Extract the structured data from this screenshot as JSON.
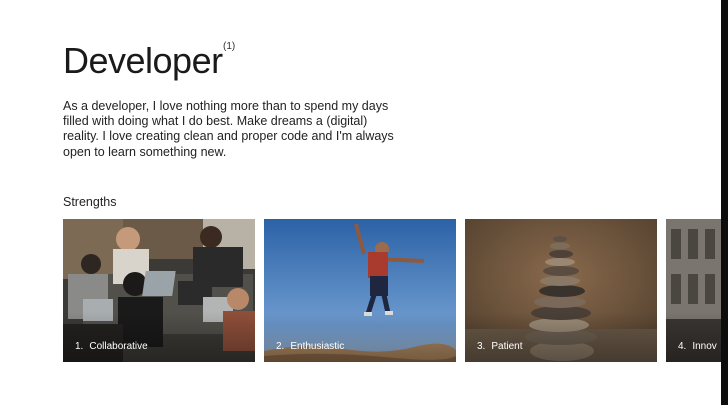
{
  "header": {
    "title": "Developer",
    "footnote_marker": "(1)"
  },
  "intro": {
    "text": "As a developer, I love nothing more than to spend my days filled with doing what I do best. Make dreams a (digital) reality. I love creating clean and proper code and I'm always open to learn something new."
  },
  "strengths": {
    "label": "Strengths",
    "items": [
      {
        "number": "1.",
        "label": "Collaborative"
      },
      {
        "number": "2.",
        "label": "Enthusiastic"
      },
      {
        "number": "3.",
        "label": "Patient"
      },
      {
        "number": "4.",
        "label": "Innov"
      }
    ]
  }
}
